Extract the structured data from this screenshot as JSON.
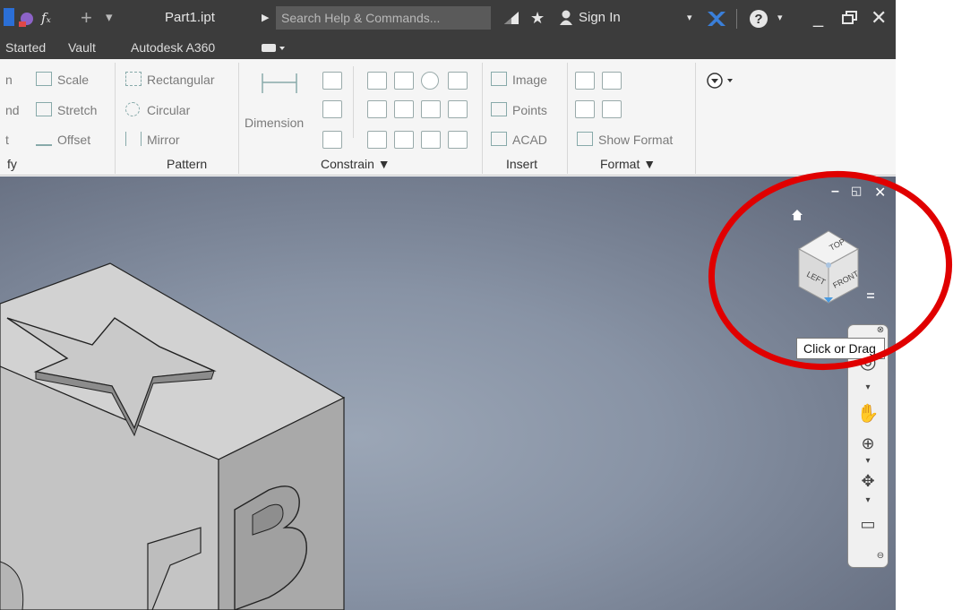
{
  "titlebar": {
    "doc_title": "Part1.ipt",
    "search_placeholder": "Search Help & Commands...",
    "signin_label": "Sign In"
  },
  "tabs": [
    "Started",
    "Vault",
    "Autodesk A360"
  ],
  "ribbon": {
    "col1": [
      "n",
      "nd",
      "t"
    ],
    "modify": [
      "Scale",
      "Stretch",
      "Offset"
    ],
    "pattern": [
      "Rectangular",
      "Circular",
      "Mirror"
    ],
    "dimension_label": "Dimension",
    "insert": [
      "Image",
      "Points",
      "ACAD"
    ],
    "format_item": "Show Format",
    "groups": {
      "modify": "fy",
      "pattern": "Pattern",
      "constrain": "Constrain ▼",
      "insert": "Insert",
      "format": "Format ▼"
    }
  },
  "viewcube": {
    "top": "TOP",
    "left": "LEFT",
    "front": "FRONT",
    "tooltip": "Click or Drag"
  },
  "colors": {
    "titlebar": "#3c3c3c",
    "ribbon": "#f5f5f5",
    "viewport": "#8893a5",
    "highlight_circle": "#e00000"
  }
}
